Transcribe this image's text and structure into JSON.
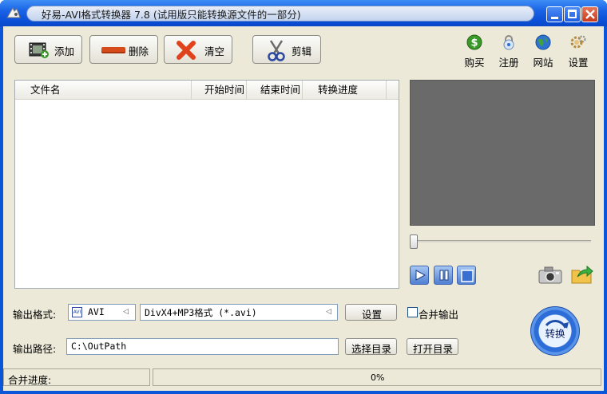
{
  "window": {
    "title": "好易-AVI格式转换器 7.8 (试用版只能转换源文件的一部分)"
  },
  "toolbar": {
    "add_label": "添加",
    "delete_label": "删除",
    "clear_label": "清空",
    "cut_label": "剪辑"
  },
  "top_links": {
    "buy": "购买",
    "register": "注册",
    "website": "网站",
    "settings": "设置"
  },
  "file_list": {
    "columns": [
      "文件名",
      "开始时间",
      "结束时间",
      "转换进度"
    ],
    "rows": []
  },
  "player": {
    "position": 0
  },
  "output": {
    "format_label": "输出格式:",
    "format_value": "AVI",
    "format_badge": "AVI",
    "profile_value": "DivX4+MP3格式 (*.avi)",
    "settings_label": "设置",
    "merge_label": "合并输出",
    "merge_checked": false,
    "path_label": "输出路径:",
    "path_value": "C:\\OutPath",
    "choose_dir_label": "选择目录",
    "open_dir_label": "打开目录"
  },
  "convert": {
    "label": "转换"
  },
  "status": {
    "merge_progress_label": "合并进度:",
    "progress_text": "0%",
    "progress": 0
  },
  "colors": {
    "titlebar": "#0a55d8",
    "client_bg": "#ece9d8",
    "preview_bg": "#6a6a6a",
    "close_red": "#c63a1d",
    "delete_bar_red": "#d64b1a"
  }
}
